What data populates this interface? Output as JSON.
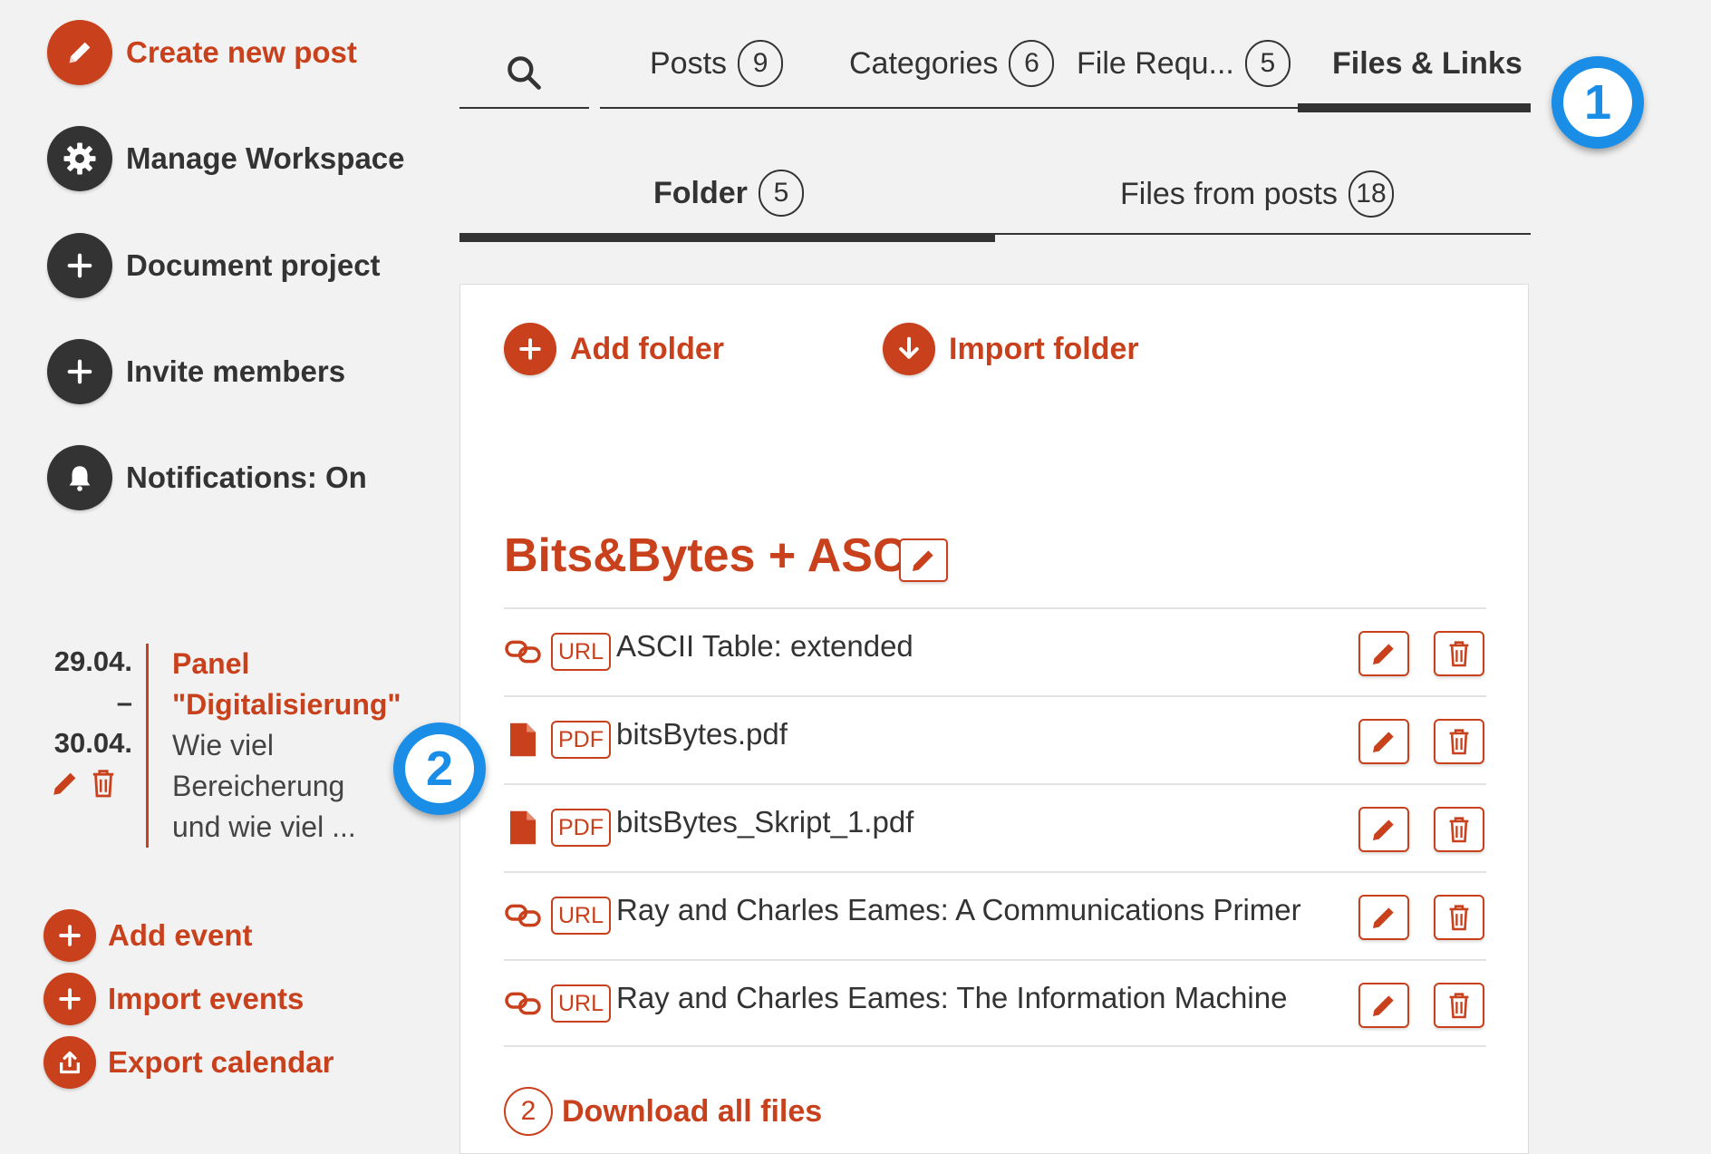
{
  "sidebar": {
    "actions": [
      {
        "label": "Create new post",
        "icon": "pencil-icon"
      },
      {
        "label": "Manage Workspace",
        "icon": "gear-icon"
      },
      {
        "label": "Document project",
        "icon": "plus-icon"
      },
      {
        "label": "Invite members",
        "icon": "plus-icon"
      },
      {
        "label": "Notifications: On",
        "icon": "bell-icon"
      }
    ],
    "event": {
      "date_start": "29.04.",
      "date_sep": "–",
      "date_end": "30.04.",
      "title_line1": "Panel",
      "title_line2": "\"Digitalisierung\"",
      "desc_line1": "Wie viel",
      "desc_line2": "Bereicherung",
      "desc_line3": "und wie viel ..."
    },
    "calendar_actions": [
      {
        "label": "Add event",
        "icon": "plus-icon"
      },
      {
        "label": "Import events",
        "icon": "plus-icon"
      },
      {
        "label": "Export calendar",
        "icon": "export-icon"
      }
    ]
  },
  "tabs": [
    {
      "label": "Posts",
      "count": "9"
    },
    {
      "label": "Categories",
      "count": "6"
    },
    {
      "label": "File Requ...",
      "count": "5"
    },
    {
      "label": "Files & Links",
      "active": true
    }
  ],
  "subtabs": [
    {
      "label": "Folder",
      "count": "5",
      "active": true
    },
    {
      "label": "Files from posts",
      "count": "18"
    }
  ],
  "panel": {
    "add_folder": "Add folder",
    "import_folder": "Import folder",
    "folder_title": "Bits&Bytes + ASCII",
    "files": [
      {
        "type": "URL",
        "name": "ASCII Table: extended",
        "icon": "link-icon"
      },
      {
        "type": "PDF",
        "name": "bitsBytes.pdf",
        "icon": "file-icon"
      },
      {
        "type": "PDF",
        "name": "bitsBytes_Skript_1.pdf",
        "icon": "file-icon"
      },
      {
        "type": "URL",
        "name": "Ray and Charles Eames: A Communications Primer",
        "icon": "link-icon"
      },
      {
        "type": "URL",
        "name": "Ray and Charles Eames: The Information Machine",
        "icon": "link-icon"
      }
    ],
    "download_count": "2",
    "download_label": "Download all files"
  },
  "callouts": [
    "1",
    "2"
  ],
  "colors": {
    "accent": "#c8411c",
    "dark": "#333333",
    "callout": "#1a8de6"
  }
}
